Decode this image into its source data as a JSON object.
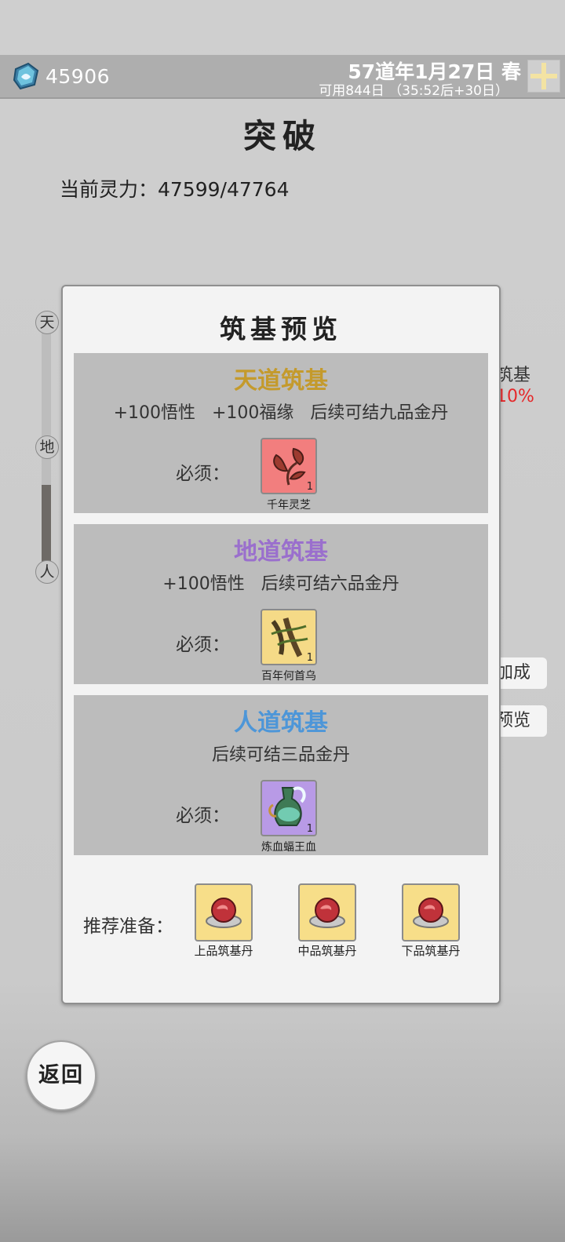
{
  "header": {
    "currency_value": "45906",
    "date": "57道年1月27日 春",
    "available_days": "可用844日 （35:52后+30日）"
  },
  "page": {
    "title": "突破",
    "spirit_power": "当前灵力：47599/47764"
  },
  "realm_slider": {
    "labels": [
      "天",
      "地",
      "人"
    ],
    "level_fraction": 0.35
  },
  "background": {
    "label_partial": "筑基",
    "percent_partial": "10%",
    "buttons": [
      "加成",
      "预览"
    ]
  },
  "modal": {
    "title": "筑基预览",
    "options": [
      {
        "title": "天道筑基",
        "title_color": "#c49a2c",
        "description": "+100悟性   +100福缘   后续可结九品金丹",
        "required_label": "必须：",
        "item": {
          "name": "千年灵芝",
          "count": "1",
          "icon": "lingzhi-icon",
          "bg_color": "#f27e7e"
        }
      },
      {
        "title": "地道筑基",
        "title_color": "#9a6fcd",
        "description": "+100悟性   后续可结六品金丹",
        "required_label": "必须：",
        "item": {
          "name": "百年何首乌",
          "count": "1",
          "icon": "heshouwu-icon",
          "bg_color": "#f5da87"
        }
      },
      {
        "title": "人道筑基",
        "title_color": "#4d96d8",
        "description": "后续可结三品金丹",
        "required_label": "必须：",
        "item": {
          "name": "炼血蝠王血",
          "count": "1",
          "icon": "blood-flask-icon",
          "bg_color": "#b89ae6"
        }
      }
    ],
    "recommended_label": "推荐准备：",
    "recommended": [
      {
        "name": "上品筑基丹",
        "icon": "pill-icon"
      },
      {
        "name": "中品筑基丹",
        "icon": "pill-icon"
      },
      {
        "name": "下品筑基丹",
        "icon": "pill-icon"
      }
    ]
  },
  "back_button": "返回"
}
